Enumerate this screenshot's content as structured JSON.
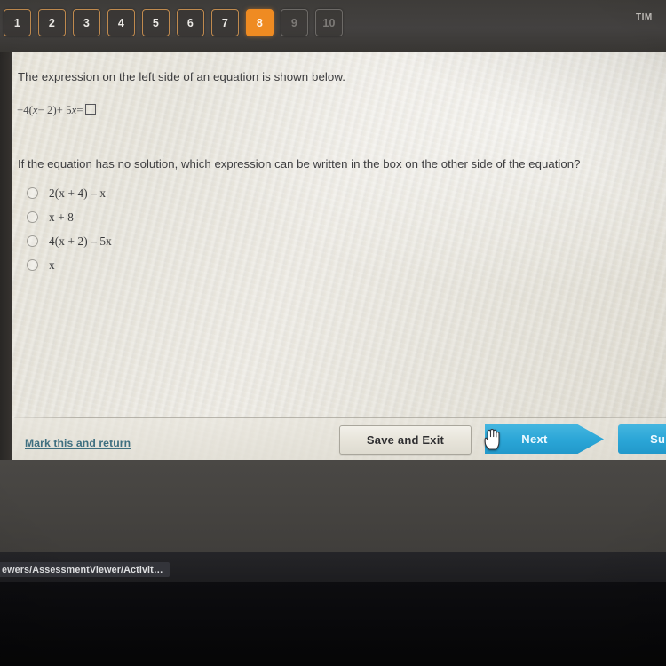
{
  "nav": {
    "question_tabs": [
      {
        "label": "1",
        "state": "available"
      },
      {
        "label": "2",
        "state": "available"
      },
      {
        "label": "3",
        "state": "available"
      },
      {
        "label": "4",
        "state": "available"
      },
      {
        "label": "5",
        "state": "available"
      },
      {
        "label": "6",
        "state": "available"
      },
      {
        "label": "7",
        "state": "available"
      },
      {
        "label": "8",
        "state": "active"
      },
      {
        "label": "9",
        "state": "disabled"
      },
      {
        "label": "10",
        "state": "disabled"
      }
    ],
    "timer_label": "TIM",
    "active_color": "#ef8b22",
    "tab_border_color": "#c08a4e"
  },
  "question": {
    "stem": "The expression on the left side of an equation is shown below.",
    "equation": {
      "lhs_prefix": "−4(",
      "var1": "x",
      "mid": "− 2)+ 5",
      "var2": "x",
      "equals": "=",
      "answer_box": "empty-box"
    },
    "equation_plain": "−4(x − 2) + 5x = □",
    "prompt": "If the equation has no solution, which expression can be written in the box on the other side of the equation?",
    "choices": [
      {
        "id": "a",
        "text": "2(x + 4) – x",
        "selected": false
      },
      {
        "id": "b",
        "text": "x + 8",
        "selected": false
      },
      {
        "id": "c",
        "text": "4(x + 2) – 5x",
        "selected": false
      },
      {
        "id": "d",
        "text": "x",
        "selected": false
      }
    ]
  },
  "footer": {
    "mark_return_label": "Mark this and return",
    "mark_return_color": "#3f6f80",
    "save_exit_label": "Save and Exit",
    "next_label": "Next",
    "submit_label": "Submit",
    "button_accent_color": "#2aa5d6"
  },
  "browser": {
    "status_url": "ewers/AssessmentViewer/Activit…"
  }
}
